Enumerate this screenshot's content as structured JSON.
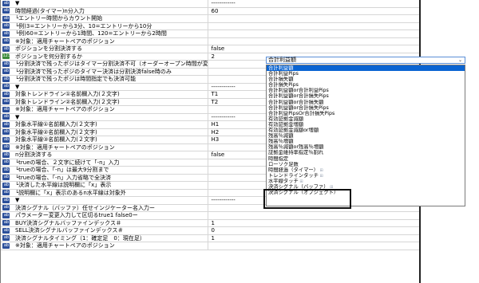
{
  "rows": [
    {
      "icon": "ab",
      "name": "▼",
      "value": "------------",
      "sel": false
    },
    {
      "icon": "ab",
      "name": "時間経過(タイマー)n分入力",
      "value": "60",
      "sel": false
    },
    {
      "icon": "ab",
      "name": "└エントリー時間からカウント開始",
      "value": "",
      "sel": false
    },
    {
      "icon": "ab",
      "name": "└例)3=エントリーから3分、10=エントリーから10分",
      "value": "",
      "sel": false
    },
    {
      "icon": "ab",
      "name": "└例)60=エントリーから1時間、120=エントリーから2時間",
      "value": "",
      "sel": false
    },
    {
      "icon": "ab",
      "name": "※対象：適用チャートペアのポジション",
      "value": "",
      "sel": false
    },
    {
      "icon": "ab",
      "name": "ポジションを分割決済する",
      "value": "false",
      "sel": false
    },
    {
      "icon": "grn",
      "name": "ポジションを何分割するか",
      "value": "2",
      "sel": true
    },
    {
      "icon": "ab",
      "name": "└分割決済で残ったポジはタイマー分割決済不可（オーダーオープン時間が変わらないため）",
      "value": "",
      "sel": false
    },
    {
      "icon": "ab",
      "name": "└分割決済で残ったポジのタイマー決済は分割決済false時のみ",
      "value": "",
      "sel": false
    },
    {
      "icon": "ab",
      "name": "└分割決済で残ったポジは時間指定でも決済可能",
      "value": "",
      "sel": false
    },
    {
      "icon": "ab",
      "name": "▼",
      "value": "------------",
      "sel": false
    },
    {
      "icon": "ab",
      "name": "対象トレンドライン①名前欄入力(２文字)",
      "value": "T1",
      "sel": false
    },
    {
      "icon": "ab",
      "name": "対象トレンドライン②名前欄入力(２文字)",
      "value": "T2",
      "sel": false
    },
    {
      "icon": "ab",
      "name": "※対象：適用チャートペアのポジション",
      "value": "",
      "sel": false
    },
    {
      "icon": "ab",
      "name": "▼",
      "value": "------------",
      "sel": false
    },
    {
      "icon": "ab",
      "name": "対象水平線①名前欄入力(２文字)",
      "value": "H1",
      "sel": false
    },
    {
      "icon": "ab",
      "name": "対象水平線②名前欄入力(２文字)",
      "value": "H2",
      "sel": false
    },
    {
      "icon": "ab",
      "name": "対象水平線③名前欄入力(２文字)",
      "value": "H3",
      "sel": false
    },
    {
      "icon": "ab",
      "name": "※対象：適用チャートペアのポジション",
      "value": "",
      "sel": false
    },
    {
      "icon": "ab",
      "name": "n分割決済する",
      "value": "false",
      "sel": false
    },
    {
      "icon": "ab",
      "name": "└trueの場合、２文字に続けて「-n」入力",
      "value": "",
      "sel": false
    },
    {
      "icon": "ab",
      "name": "└trueの場合、「-n」は最大9分割まで",
      "value": "",
      "sel": false
    },
    {
      "icon": "ab",
      "name": "└trueの場合、「-n」入力省略で全決済",
      "value": "",
      "sel": false
    },
    {
      "icon": "ab",
      "name": "└決済した水平線は説明欄に「x」表示",
      "value": "",
      "sel": false
    },
    {
      "icon": "ab",
      "name": "└説明欄に「x」表示のあるn水平線は対象外",
      "value": "",
      "sel": false
    },
    {
      "icon": "ab",
      "name": "▼",
      "value": "------------",
      "sel": false
    },
    {
      "icon": "ab",
      "name": "決済シグナル（バッファ）任せインジケーター名入力ー",
      "value": "",
      "sel": false
    },
    {
      "icon": "ab",
      "name": "パラメーター変更入力して区切るtrue1 false0ー",
      "value": "",
      "sel": false
    },
    {
      "icon": "ab",
      "name": "BUY決済シグナルバッファインデックス＃",
      "value": "1",
      "sel": false
    },
    {
      "icon": "ab",
      "name": "SELL決済シグナルバッファインデックス＃",
      "value": "0",
      "sel": false
    },
    {
      "icon": "ab",
      "name": "決済シグナルタイミング（1：確定足　0：現在足）",
      "value": "1",
      "sel": false
    },
    {
      "icon": "ab",
      "name": "※対象：適用チャートペアのポジション",
      "value": "",
      "sel": false
    }
  ],
  "dropdown": {
    "selected": "合計利益額",
    "options": [
      "合計利益額",
      "合計利益Pips",
      "合計損失額",
      "合計損失Pips",
      "合計利益額or合計利益Pips",
      "合計利益額or合計損失Pips",
      "合計利益額or合計損失額",
      "合計利益額or合計損失Pips",
      "合計利益PipsOr合計損失Pips",
      "有効証拠金減額",
      "有効証拠金増額",
      "有効証拠金減額or増額",
      "残高％減額",
      "残高％増額",
      "残高％減額or残高％増額",
      "証拠金維持率指定％割れ",
      "時間指定",
      "ローソク足数",
      "時間経過（タイマー）",
      "トレンドラインタッチ",
      "水平線タッチ",
      "決済シグナル（バッファ）",
      "決済シグナル（オブジェクト）"
    ],
    "marked": [
      18,
      19,
      20,
      21
    ]
  }
}
